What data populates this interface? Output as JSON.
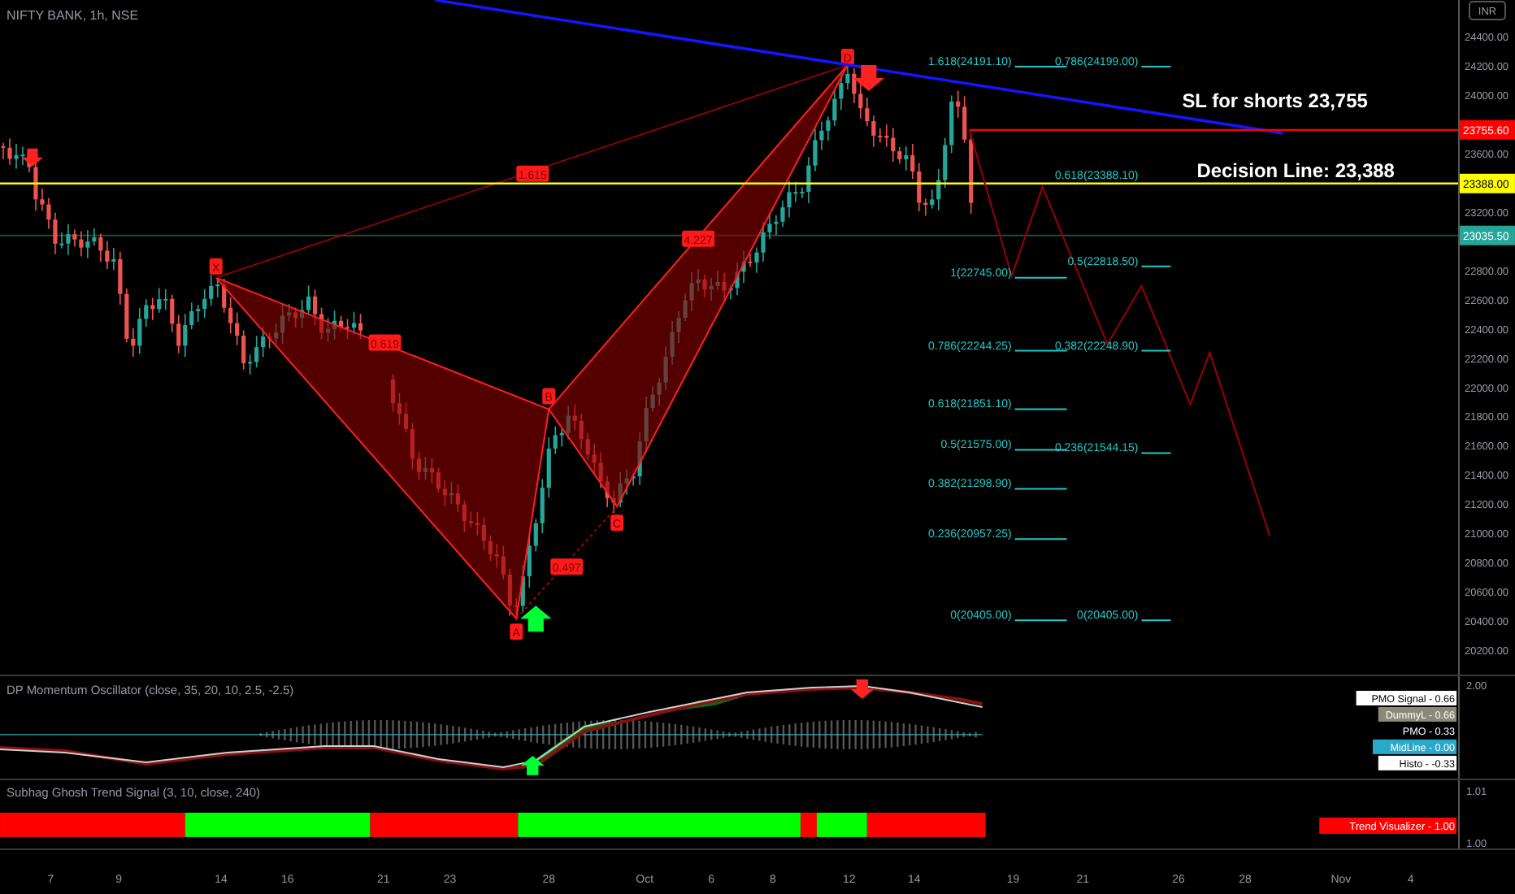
{
  "symbol_title": "NIFTY BANK, 1h, NSE",
  "currency_badge": "INR",
  "price_axis": {
    "labels": [
      "24400.00",
      "24200.00",
      "24000.00",
      "23600.00",
      "23200.00",
      "22800.00",
      "22600.00",
      "22400.00",
      "22200.00",
      "22000.00",
      "21800.00",
      "21600.00",
      "21400.00",
      "21200.00",
      "21000.00",
      "20800.00",
      "20600.00",
      "20400.00",
      "20200.00"
    ],
    "tags": [
      {
        "text": "23755.60",
        "color": "#ff0000"
      },
      {
        "text": "23388.00",
        "color": "#ffff00"
      },
      {
        "text": "23035.50",
        "color": "#26a69a"
      }
    ]
  },
  "annotations": [
    {
      "text": "SL for shorts 23,755"
    },
    {
      "text": "Decision Line: 23,388"
    }
  ],
  "pattern": {
    "points": [
      "X",
      "A",
      "B",
      "C",
      "D"
    ],
    "ratios": [
      "1.615",
      "0.619",
      "0.497",
      "4.227"
    ]
  },
  "fib_left": [
    "1.618(24191.10)",
    "1(22745.00)",
    "0.786(22244.25)",
    "0.618(21851.10)",
    "0.5(21575.00)",
    "0.382(21298.90)",
    "0.236(20957.25)",
    "0(20405.00)"
  ],
  "fib_right": [
    "0.786(24199.00)",
    "0.618(23388.10)",
    "0.5(22818.50)",
    "0.382(22248.90)",
    "0.236(21544.15)",
    "0(20405.00)"
  ],
  "oscillator": {
    "title": "DP Momentum Oscillator (close, 35, 20, 10, 2.5, -2.5)",
    "axis_label": "2.00",
    "legend": [
      {
        "text": "PMO Signal - 0.66",
        "color": "#ffffff"
      },
      {
        "text": "DummyL - 0.66",
        "color": "#8a8a78"
      },
      {
        "text": "PMO - 0.33",
        "color": "#000000"
      },
      {
        "text": "MidLine - 0.00",
        "color": "#29a9c9"
      },
      {
        "text": "Histo - -0.33",
        "color": "#ffffff"
      }
    ]
  },
  "trend_signal": {
    "title": "Subhag Ghosh Trend Signal (3, 10, close, 240)",
    "axis_labels": [
      "1.01",
      "1.00"
    ],
    "segments": [
      {
        "color": "#ff0000"
      },
      {
        "color": "#00ff00"
      },
      {
        "color": "#ff0000"
      },
      {
        "color": "#00ff00"
      },
      {
        "color": "#ff0000"
      },
      {
        "color": "#00ff00"
      },
      {
        "color": "#ff0000"
      }
    ],
    "legend": {
      "text": "Trend Visualizer - 1.00",
      "color": "#ff0000"
    }
  },
  "time_axis": [
    "7",
    "9",
    "14",
    "16",
    "21",
    "23",
    "28",
    "Oct",
    "6",
    "8",
    "12",
    "14",
    "19",
    "21",
    "26",
    "28",
    "Nov",
    "4"
  ]
}
